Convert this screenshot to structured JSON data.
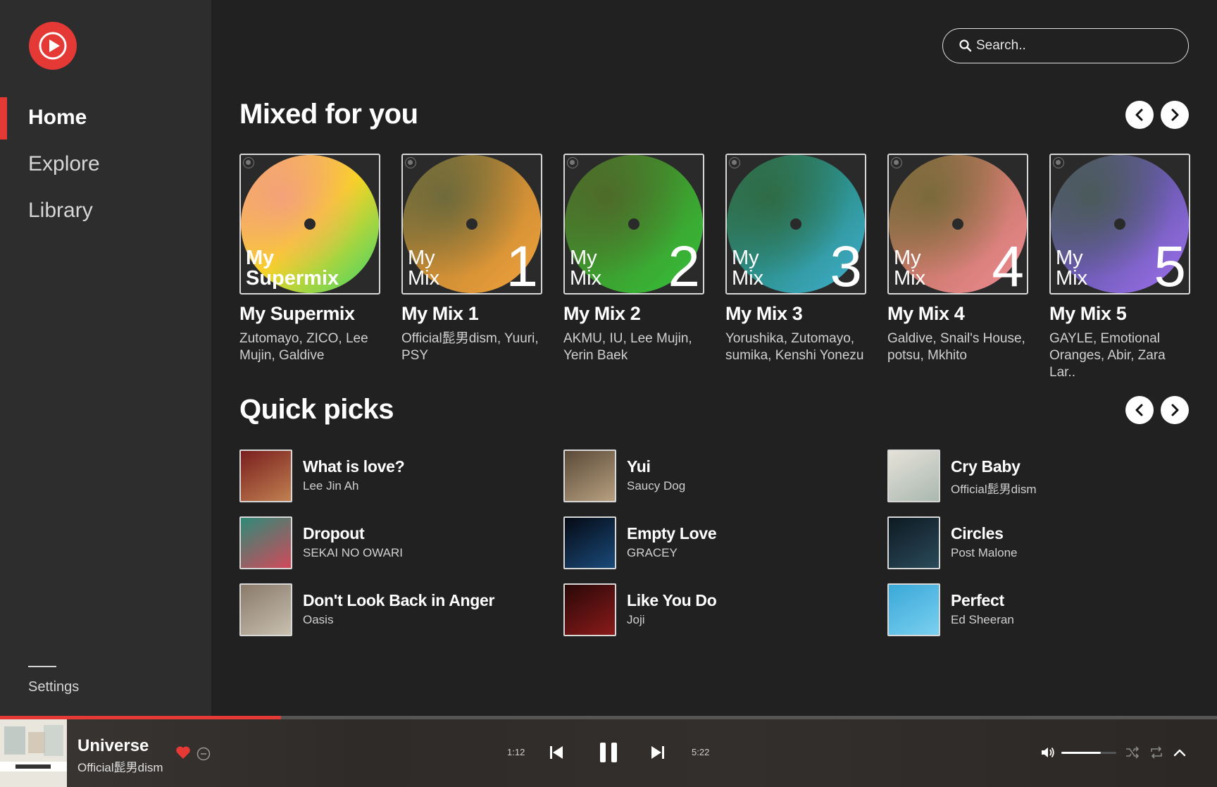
{
  "app": {
    "logo_icon": "youtube-music-play-icon",
    "accent": "#e53935"
  },
  "sidebar": {
    "items": [
      {
        "label": "Home",
        "active": true
      },
      {
        "label": "Explore",
        "active": false
      },
      {
        "label": "Library",
        "active": false
      }
    ],
    "settings_label": "Settings"
  },
  "search": {
    "placeholder": "Search..",
    "icon": "search-icon"
  },
  "mixed": {
    "title": "Mixed for you",
    "cards": [
      {
        "cover_line1": "My",
        "cover_line2": "Supermix",
        "number": "",
        "title": "My Supermix",
        "artists": "Zutomayo, ZICO, Lee Mujin, Galdive",
        "colors": [
          "#f4a17a",
          "#f9d423",
          "#3ad667"
        ]
      },
      {
        "cover_line1": "My",
        "cover_line2": "Mix",
        "number": "1",
        "title": "My Mix 1",
        "artists": "Official髭男dism, Yuuri, PSY",
        "colors": [
          "#6e6a3a",
          "#c98b34",
          "#f3a33b"
        ]
      },
      {
        "cover_line1": "My",
        "cover_line2": "Mix",
        "number": "2",
        "title": "My Mix 2",
        "artists": "AKMU, IU, Lee Mujin, Yerin Baek",
        "colors": [
          "#4d6b2a",
          "#3e9a2e",
          "#35c23a"
        ]
      },
      {
        "cover_line1": "My",
        "cover_line2": "Mix",
        "number": "3",
        "title": "My Mix 3",
        "artists": "Yorushika, Zutomayo, sumika, Kenshi Yonezu",
        "colors": [
          "#2f6b45",
          "#2c8f8a",
          "#40b0d0"
        ]
      },
      {
        "cover_line1": "My",
        "cover_line2": "Mix",
        "number": "4",
        "title": "My Mix 4",
        "artists": "Galdive, Snail's House, potsu, Mkhito",
        "colors": [
          "#7a6a3a",
          "#c97a6a",
          "#f08a95"
        ]
      },
      {
        "cover_line1": "My",
        "cover_line2": "Mix",
        "number": "5",
        "title": "My Mix 5",
        "artists": "GAYLE, Emotional Oranges, Abir, Zara Lar..",
        "colors": [
          "#4a5a5a",
          "#6a5ab0",
          "#a070f0"
        ]
      }
    ]
  },
  "quick": {
    "title": "Quick picks",
    "items": [
      {
        "title": "What is love?",
        "artist": "Lee Jin Ah",
        "art": [
          "#7a1f1f",
          "#c08050"
        ]
      },
      {
        "title": "Yui",
        "artist": "Saucy Dog",
        "art": [
          "#5a4a38",
          "#b8a080"
        ]
      },
      {
        "title": "Cry Baby",
        "artist": "Official髭男dism",
        "art": [
          "#e6e2d8",
          "#a9b8b0"
        ]
      },
      {
        "title": "Dropout",
        "artist": "SEKAI NO OWARI",
        "art": [
          "#2f8a78",
          "#d04a5a"
        ]
      },
      {
        "title": "Empty Love",
        "artist": "GRACEY",
        "art": [
          "#050a14",
          "#1a4a7a"
        ]
      },
      {
        "title": "Circles",
        "artist": "Post Malone",
        "art": [
          "#0e1a22",
          "#2a4a5a"
        ]
      },
      {
        "title": "Don't Look Back in Anger",
        "artist": "Oasis",
        "art": [
          "#8a7a6a",
          "#c8c0b0"
        ]
      },
      {
        "title": "Like You Do",
        "artist": "Joji",
        "art": [
          "#2a0808",
          "#8a1a1a"
        ]
      },
      {
        "title": "Perfect",
        "artist": "Ed Sheeran",
        "art": [
          "#3aa8d8",
          "#7ad0f0"
        ]
      }
    ]
  },
  "player": {
    "title": "Universe",
    "artist": "Official髭男dism",
    "elapsed": "1:12",
    "duration": "5:22",
    "progress": 0.231,
    "volume": 0.72,
    "liked": true
  }
}
